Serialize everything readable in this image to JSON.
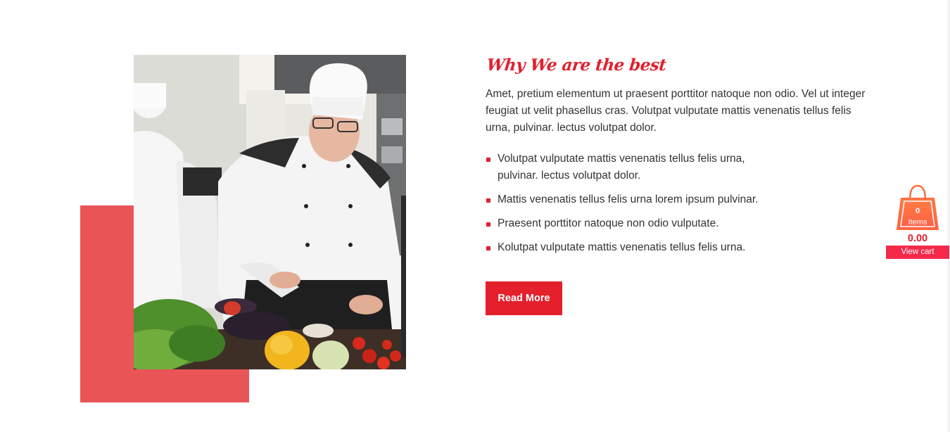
{
  "section": {
    "heading": "Why We are the best",
    "intro": "Amet, pretium elementum ut praesent porttitor natoque non odio. Vel ut integer feugiat ut velit phasellus cras. Volutpat vulputate mattis venenatis tellus felis urna, pulvinar. lectus volutpat dolor.",
    "features": [
      "Volutpat vulputate mattis venenatis tellus felis urna, pulvinar. lectus volutpat dolor.",
      "Mattis venenatis tellus felis urna lorem ipsum pulvinar.",
      "Praesent porttitor natoque non odio vulputate.",
      "Kolutpat vulputate mattis venenatis tellus felis urna."
    ],
    "button_label": "Read More"
  },
  "cart": {
    "count": "0",
    "items_label": "Items",
    "total": "0.00",
    "view_cart_label": "View cart"
  },
  "colors": {
    "accent": "#e0202d",
    "block": "#e95457",
    "view_cart_bg": "#f5294a",
    "cart_bag": "#ff6b3d"
  },
  "icons": {
    "cart": "shopping-bag-icon",
    "bullet": "square-bullet-icon"
  }
}
